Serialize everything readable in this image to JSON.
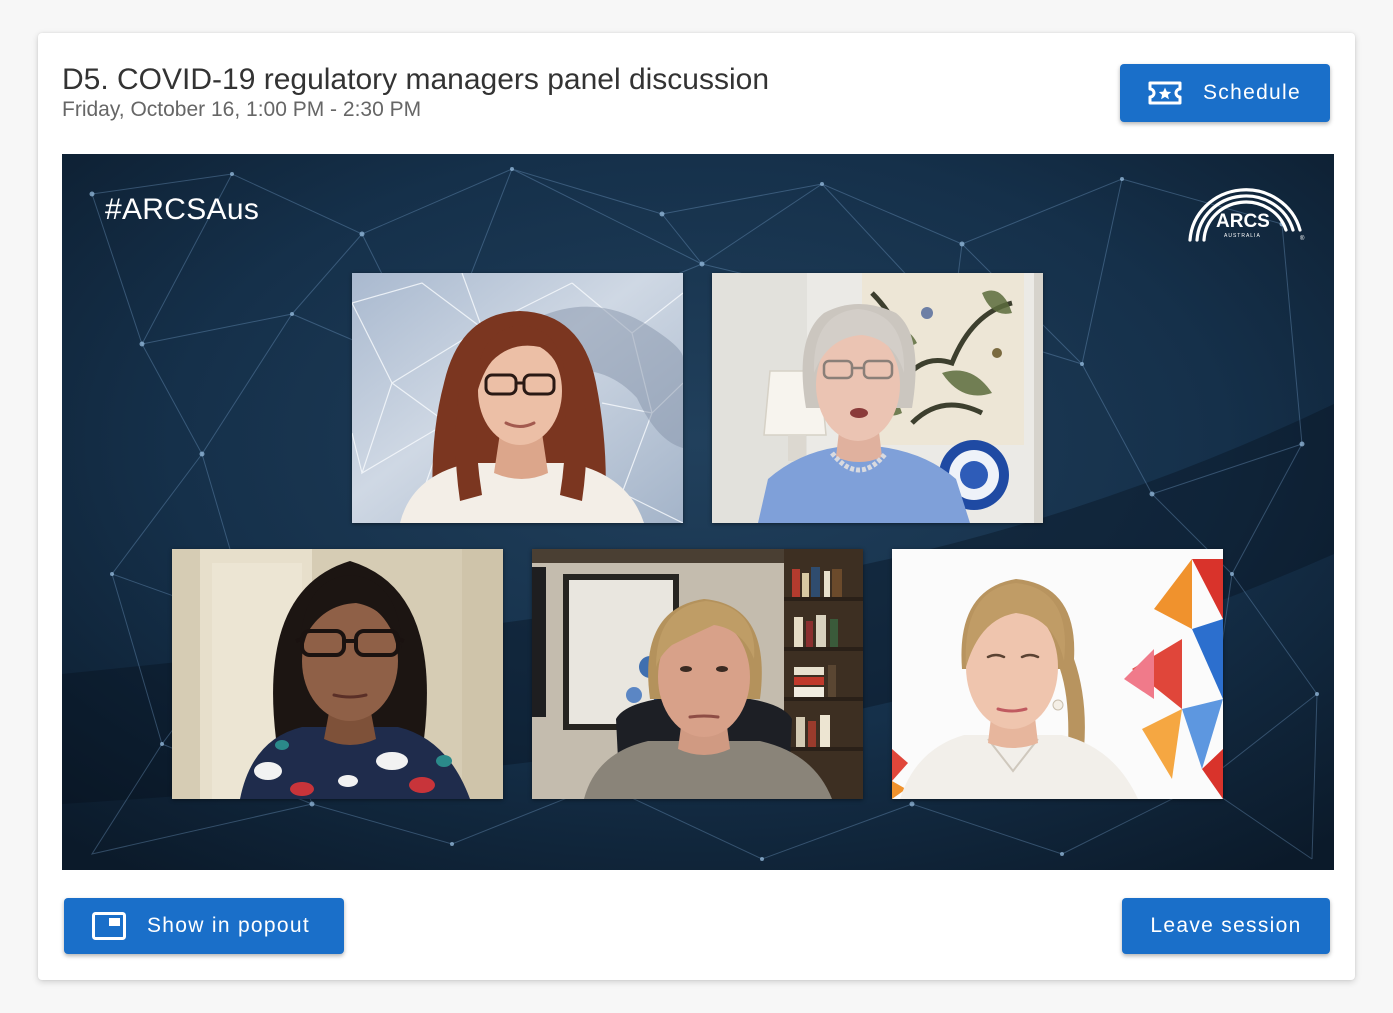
{
  "session": {
    "title": "D5. COVID-19 regulatory managers panel discussion",
    "datetime": "Friday, October 16, 1:00 PM - 2:30 PM"
  },
  "toolbar": {
    "schedule": {
      "label": "Schedule",
      "icon": "ticket-icon"
    }
  },
  "stream": {
    "hashtag": "#ARCSAus",
    "logo": {
      "wordmark": "ARCS",
      "tagline": "AUSTRALIA",
      "registered_mark": "®"
    }
  },
  "footer": {
    "popout": {
      "label": "Show in popout",
      "icon": "picture-in-picture-icon"
    },
    "leave": {
      "label": "Leave session"
    }
  },
  "colors": {
    "accent": "#1a6fc9",
    "stream_background": "#10233a"
  }
}
